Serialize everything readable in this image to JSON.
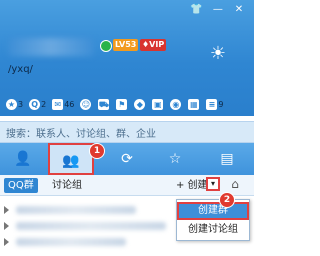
{
  "window": {
    "controls": {
      "shirt": "👕",
      "minimize": "—",
      "close": "✕"
    }
  },
  "profile": {
    "level_badge": "LV53",
    "vip_badge": "♦VIP",
    "signature": "/yxq/",
    "weather": "☀"
  },
  "toolbar": {
    "items": [
      {
        "icon": "★",
        "count": "3"
      },
      {
        "icon": "Q",
        "count": "2"
      },
      {
        "icon": "✉",
        "count": "46"
      },
      {
        "icon": "☺",
        "count": ""
      },
      {
        "icon": "⛟",
        "count": ""
      },
      {
        "icon": "⚑",
        "count": ""
      },
      {
        "icon": "◆",
        "count": ""
      },
      {
        "icon": "▣",
        "count": ""
      },
      {
        "icon": "◉",
        "count": ""
      },
      {
        "icon": "▦",
        "count": ""
      },
      {
        "icon": "≡",
        "count": "9"
      }
    ]
  },
  "search": {
    "placeholder": "搜索：联系人、讨论组、群、企业"
  },
  "tabs": [
    {
      "icon": "👤"
    },
    {
      "icon": "👥"
    },
    {
      "icon": "⟳"
    },
    {
      "icon": "☆"
    },
    {
      "icon": "▤"
    }
  ],
  "annotations": {
    "marker1": "1",
    "marker2": "2"
  },
  "group_tabs": {
    "qq_group": "QQ群",
    "discussion": "讨论组",
    "create": "+ 创建",
    "dropdown": "▾",
    "home": "⌂"
  },
  "create_menu": {
    "items": [
      {
        "label": "创建群"
      },
      {
        "label": "创建讨论组"
      }
    ]
  }
}
